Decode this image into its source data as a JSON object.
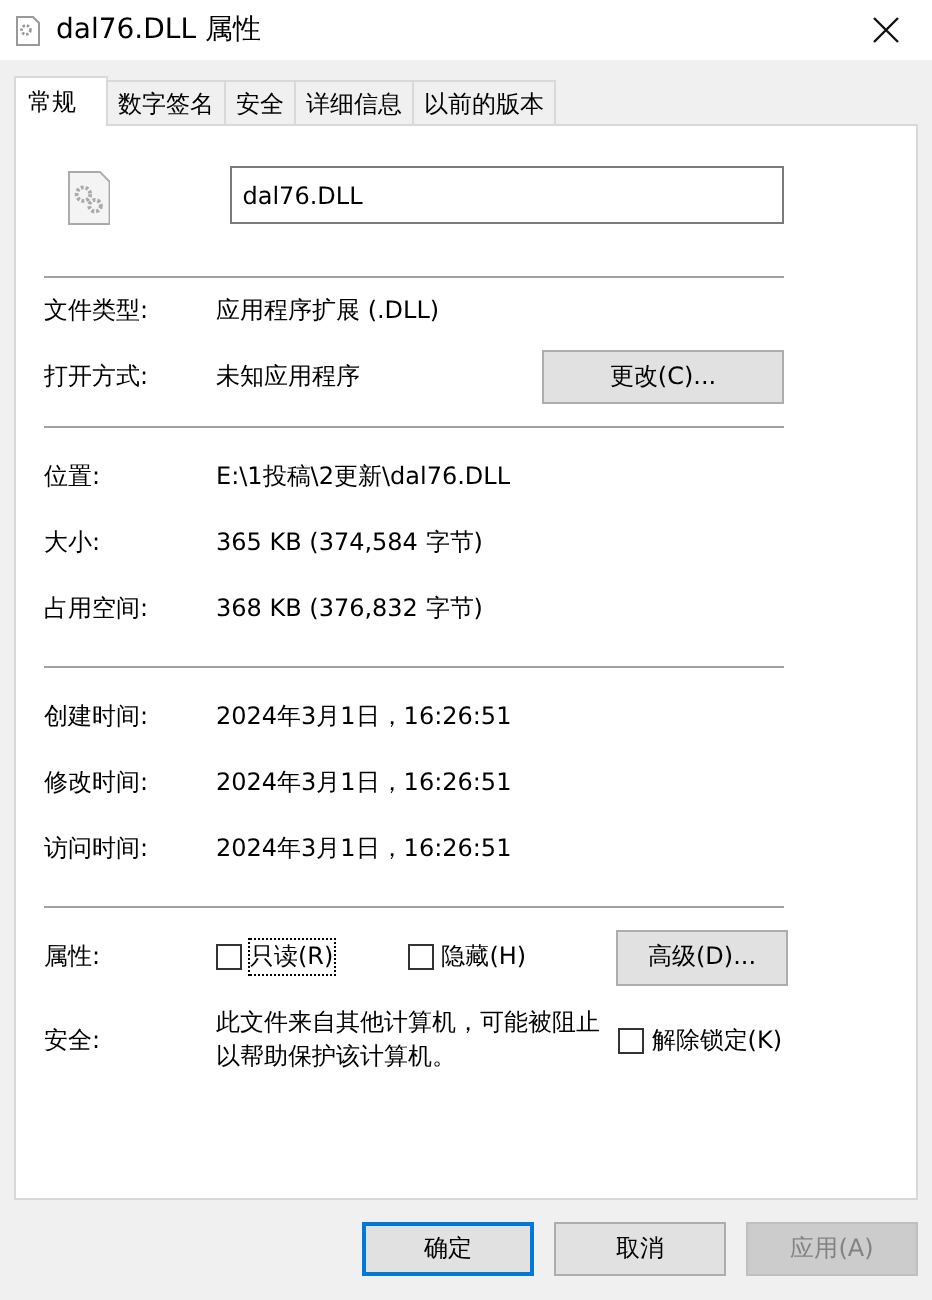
{
  "window": {
    "title": "dal76.DLL 属性"
  },
  "tabs": [
    {
      "label": "常规",
      "selected": true
    },
    {
      "label": "数字签名",
      "selected": false
    },
    {
      "label": "安全",
      "selected": false
    },
    {
      "label": "详细信息",
      "selected": false
    },
    {
      "label": "以前的版本",
      "selected": false
    }
  ],
  "file_name": {
    "value": "dal76.DLL"
  },
  "sections": [
    {
      "rows": [
        {
          "label": "文件类型:",
          "value": "应用程序扩展 (.DLL)"
        },
        {
          "label": "打开方式:",
          "value": "未知应用程序",
          "button": "更改(C)..."
        }
      ]
    },
    {
      "rows": [
        {
          "label": "位置:",
          "value": "E:\\1投稿\\2更新\\dal76.DLL"
        },
        {
          "label": "大小:",
          "value": "365 KB (374,584 字节)"
        },
        {
          "label": "占用空间:",
          "value": "368 KB (376,832 字节)"
        }
      ]
    },
    {
      "rows": [
        {
          "label": "创建时间:",
          "value": "2024年3月1日，16:26:51"
        },
        {
          "label": "修改时间:",
          "value": "2024年3月1日，16:26:51"
        },
        {
          "label": "访问时间:",
          "value": "2024年3月1日，16:26:51"
        }
      ]
    }
  ],
  "attributes": {
    "label": "属性:",
    "options": [
      {
        "label": "只读(R)",
        "checked": false,
        "focused": true
      },
      {
        "label": "隐藏(H)",
        "checked": false,
        "focused": false
      }
    ],
    "button": "高级(D)..."
  },
  "security": {
    "label": "安全:",
    "text": "此文件来自其他计算机，可能被阻止以帮助保护该计算机。",
    "option": {
      "label": "解除锁定(K)",
      "checked": false
    }
  },
  "buttons": [
    {
      "label": "确定",
      "default": true,
      "disabled": false
    },
    {
      "label": "取消",
      "default": false,
      "disabled": false
    },
    {
      "label": "应用(A)",
      "default": false,
      "disabled": true
    }
  ]
}
